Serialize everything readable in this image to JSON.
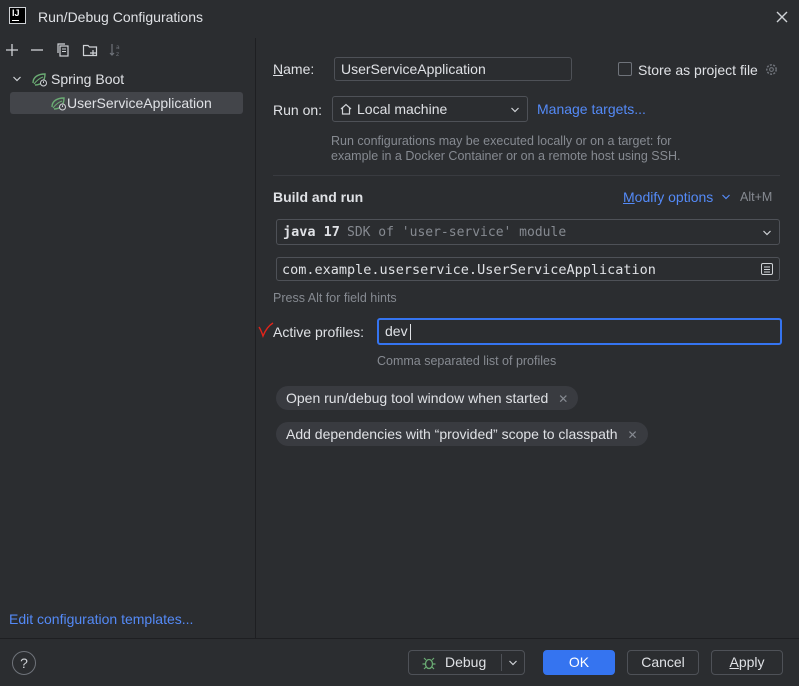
{
  "window": {
    "app_icon_text": "IJ",
    "title": "Run/Debug Configurations"
  },
  "left": {
    "toolbar_icons": [
      "add-icon",
      "remove-icon",
      "copy-icon",
      "new-folder-icon",
      "sort-icon"
    ],
    "tree": {
      "group_label": "Spring Boot",
      "item_label": "UserServiceApplication"
    },
    "edit_templates_link": "Edit configuration templates..."
  },
  "form": {
    "name_label": "Name:",
    "name_value": "UserServiceApplication",
    "store_label": "Store as project file",
    "store_checked": false,
    "run_on_label": "Run on:",
    "run_on_value": "Local machine",
    "manage_targets": "Manage targets...",
    "run_on_hint_line1": "Run configurations may be executed locally or on a target: for",
    "run_on_hint_line2": "example in a Docker Container or on a remote host using SSH.",
    "build_and_run_title": "Build and run",
    "modify_options": "Modify options",
    "modify_shortcut": "Alt+M",
    "jdk_version": "java 17",
    "jdk_desc": "SDK of 'user-service' module",
    "main_class": "com.example.userservice.UserServiceApplication",
    "field_hints": "Press Alt for field hints",
    "active_profiles_label": "Active profiles:",
    "active_profiles_value": "dev",
    "active_profiles_hint": "Comma separated list of profiles",
    "chips": [
      "Open run/debug tool window when started",
      "Add dependencies with “provided” scope to classpath"
    ]
  },
  "footer": {
    "help": "?",
    "debug_label": "Debug",
    "ok_label": "OK",
    "cancel_label": "Cancel",
    "apply_label": "Apply"
  },
  "colors": {
    "background": "#2b2d30",
    "accent": "#3574f0",
    "link": "#548af7",
    "spring_green": "#6aab73",
    "annotation_red": "#e0241b"
  }
}
